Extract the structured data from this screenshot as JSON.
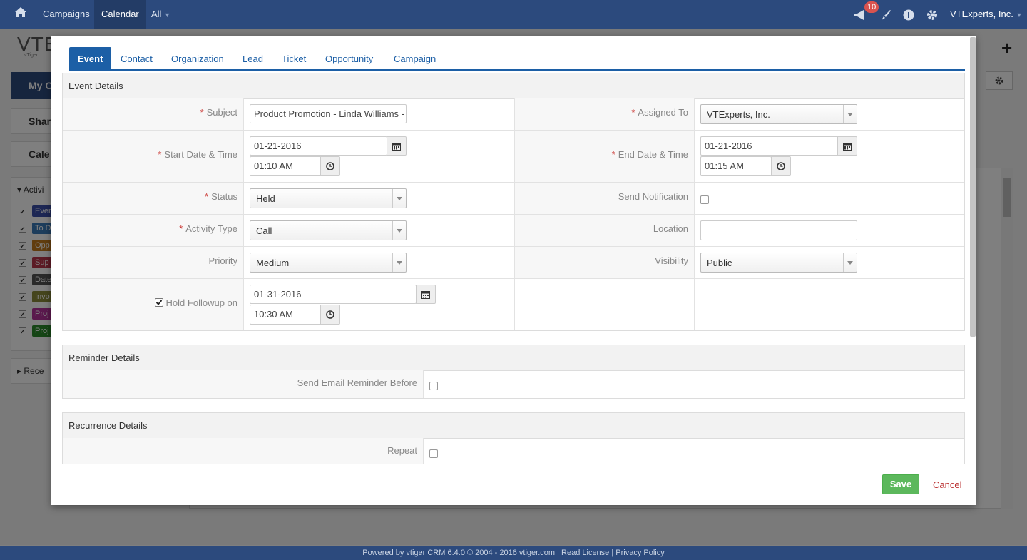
{
  "topbar": {
    "nav": [
      "Campaigns",
      "Calendar",
      "All"
    ],
    "notifications_count": "10",
    "company": "VTExperts, Inc."
  },
  "footer": {
    "text": "Powered by vtiger CRM 6.4.0  © 2004 - 2016  vtiger.com | Read License | Privacy Policy"
  },
  "background": {
    "logo": "VTE",
    "logo_sub": "vTiger",
    "sidebar": {
      "my_calendar": "My C",
      "shared": "Shar",
      "calendar_settings": "Cale",
      "activity_types": "Activi",
      "recently": "Rece",
      "types": [
        "Even",
        "To D",
        "Opp",
        "Sup",
        "Date",
        "Invo",
        "Proj",
        "Proj"
      ]
    }
  },
  "modal": {
    "tabs": [
      "Event",
      "Contact",
      "Organization",
      "Lead",
      "Ticket",
      "Opportunity",
      "Campaign"
    ],
    "event_details": {
      "title": "Event Details",
      "subject_label": "Subject",
      "subject_value": "Product Promotion - Linda Williams -",
      "assigned_label": "Assigned To",
      "assigned_value": "VTExperts, Inc.",
      "start_label": "Start Date & Time",
      "start_date": "01-21-2016",
      "start_time": "01:10 AM",
      "end_label": "End Date & Time",
      "end_date": "01-21-2016",
      "end_time": "01:15 AM",
      "status_label": "Status",
      "status_value": "Held",
      "notify_label": "Send Notification",
      "activity_label": "Activity Type",
      "activity_value": "Call",
      "location_label": "Location",
      "location_value": "",
      "priority_label": "Priority",
      "priority_value": "Medium",
      "visibility_label": "Visibility",
      "visibility_value": "Public",
      "followup_label": "Hold Followup on",
      "followup_date": "01-31-2016",
      "followup_time": "10:30 AM"
    },
    "reminder_details": {
      "title": "Reminder Details",
      "email_label": "Send Email Reminder Before"
    },
    "recurrence_details": {
      "title": "Recurrence Details",
      "repeat_label": "Repeat"
    },
    "save_label": "Save",
    "cancel_label": "Cancel"
  },
  "colors": {
    "topbar": "#2c4a7d",
    "accent": "#1c5fa6",
    "save": "#5cb85c",
    "required": "#c9302c"
  }
}
